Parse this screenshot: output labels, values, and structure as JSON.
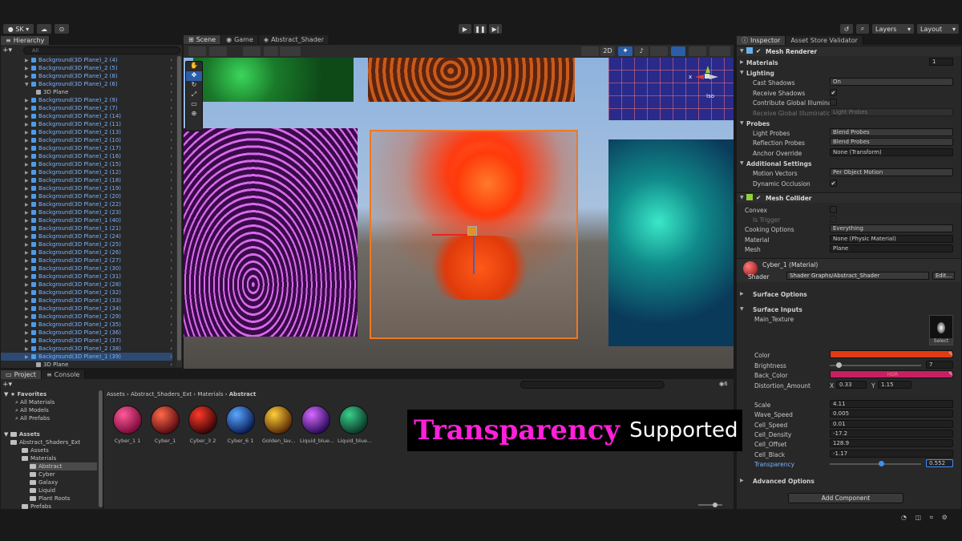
{
  "topbar": {
    "account": "SK",
    "layers": "Layers",
    "layout": "Layout"
  },
  "hierarchy": {
    "tab": "Hierarchy",
    "search_placeholder": "All",
    "rows": [
      {
        "label": "Background(3D Plane)_2 (4)",
        "indent": 0
      },
      {
        "label": "Background(3D Plane)_2 (5)",
        "indent": 0
      },
      {
        "label": "Background(3D Plane)_2 (8)",
        "indent": 0
      },
      {
        "label": "Background(3D Plane)_2 (6)",
        "indent": 0,
        "open": true
      },
      {
        "label": "3D Plane",
        "indent": 1,
        "child": true
      },
      {
        "label": "Background(3D Plane)_2 (9)",
        "indent": 0
      },
      {
        "label": "Background(3D Plane)_2 (7)",
        "indent": 0
      },
      {
        "label": "Background(3D Plane)_2 (14)",
        "indent": 0
      },
      {
        "label": "Background(3D Plane)_2 (11)",
        "indent": 0
      },
      {
        "label": "Background(3D Plane)_2 (13)",
        "indent": 0
      },
      {
        "label": "Background(3D Plane)_2 (10)",
        "indent": 0
      },
      {
        "label": "Background(3D Plane)_2 (17)",
        "indent": 0
      },
      {
        "label": "Background(3D Plane)_2 (16)",
        "indent": 0
      },
      {
        "label": "Background(3D Plane)_2 (15)",
        "indent": 0
      },
      {
        "label": "Background(3D Plane)_2 (12)",
        "indent": 0
      },
      {
        "label": "Background(3D Plane)_2 (18)",
        "indent": 0
      },
      {
        "label": "Background(3D Plane)_2 (19)",
        "indent": 0
      },
      {
        "label": "Background(3D Plane)_2 (20)",
        "indent": 0
      },
      {
        "label": "Background(3D Plane)_2 (22)",
        "indent": 0
      },
      {
        "label": "Background(3D Plane)_2 (23)",
        "indent": 0
      },
      {
        "label": "Background(3D Plane)_1 (40)",
        "indent": 0
      },
      {
        "label": "Background(3D Plane)_1 (21)",
        "indent": 0
      },
      {
        "label": "Background(3D Plane)_2 (24)",
        "indent": 0
      },
      {
        "label": "Background(3D Plane)_2 (25)",
        "indent": 0
      },
      {
        "label": "Background(3D Plane)_2 (26)",
        "indent": 0
      },
      {
        "label": "Background(3D Plane)_2 (27)",
        "indent": 0
      },
      {
        "label": "Background(3D Plane)_2 (30)",
        "indent": 0
      },
      {
        "label": "Background(3D Plane)_2 (31)",
        "indent": 0
      },
      {
        "label": "Background(3D Plane)_2 (28)",
        "indent": 0
      },
      {
        "label": "Background(3D Plane)_2 (32)",
        "indent": 0
      },
      {
        "label": "Background(3D Plane)_2 (33)",
        "indent": 0
      },
      {
        "label": "Background(3D Plane)_2 (34)",
        "indent": 0
      },
      {
        "label": "Background(3D Plane)_2 (29)",
        "indent": 0
      },
      {
        "label": "Background(3D Plane)_2 (35)",
        "indent": 0
      },
      {
        "label": "Background(3D Plane)_2 (36)",
        "indent": 0
      },
      {
        "label": "Background(3D Plane)_2 (37)",
        "indent": 0
      },
      {
        "label": "Background(3D Plane)_2 (38)",
        "indent": 0
      },
      {
        "label": "Background(3D Plane)_1 (39)",
        "indent": 0,
        "selected": true
      },
      {
        "label": "3D Plane",
        "indent": 1,
        "child": true
      }
    ]
  },
  "scene": {
    "tabs": [
      "Scene",
      "Game",
      "Abstract_Shader"
    ],
    "mode_2d": "2D",
    "iso": "Iso"
  },
  "inspector": {
    "tabs": [
      "Inspector",
      "Asset Store Validator"
    ],
    "mesh_renderer": "Mesh Renderer",
    "materials_label": "Materials",
    "materials_count": "1",
    "lighting": "Lighting",
    "cast_shadows_label": "Cast Shadows",
    "cast_shadows": "On",
    "receive_shadows": "Receive Shadows",
    "contribute_gi": "Contribute Global Illuminat",
    "receive_gi_label": "Receive Global Illumination",
    "receive_gi": "Light Probes",
    "probes": "Probes",
    "light_probes_label": "Light Probes",
    "light_probes": "Blend Probes",
    "reflection_probes_label": "Reflection Probes",
    "reflection_probes": "Blend Probes",
    "anchor_override_label": "Anchor Override",
    "anchor_override": "None (Transform)",
    "additional_settings": "Additional Settings",
    "motion_vectors_label": "Motion Vectors",
    "motion_vectors": "Per Object Motion",
    "dynamic_occlusion": "Dynamic Occlusion",
    "mesh_collider": "Mesh Collider",
    "convex": "Convex",
    "is_trigger": "Is Trigger",
    "cooking_label": "Cooking Options",
    "cooking": "Everything",
    "material_label": "Material",
    "material": "None (Physic Material)",
    "mesh_label": "Mesh",
    "mesh": "Plane",
    "material_name": "Cyber_1 (Material)",
    "shader_label": "Shader",
    "shader": "Shader Graphs/Abstract_Shader",
    "edit": "Edit...",
    "surface_options": "Surface Options",
    "surface_inputs": "Surface Inputs",
    "main_texture": "Main_Texture",
    "select": "Select",
    "color_label": "Color",
    "brightness_label": "Brightness",
    "brightness": "7",
    "back_color_label": "Back_Color",
    "hdr": "HDR",
    "distortion_label": "Distortion_Amount",
    "dist_x_label": "X",
    "dist_x": "0.33",
    "dist_y_label": "Y",
    "dist_y": "1.15",
    "scale_label": "Scale",
    "scale": "4.11",
    "wave_speed_label": "Wave_Speed",
    "wave_speed": "0.005",
    "cell_speed_label": "Cell_Speed",
    "cell_speed": "0.01",
    "cell_density_label": "Cell_Density",
    "cell_density": "-17.2",
    "cell_offset_label": "Cell_Offset",
    "cell_offset": "128.9",
    "cell_black_label": "Cell_Black",
    "cell_black": "-1.17",
    "transparency_label": "Transparency",
    "transparency": "0.552",
    "advanced_options": "Advanced Options",
    "add_component": "Add Component",
    "colors": {
      "color": "#e23a12",
      "back_color": "#c81f62"
    },
    "slider_levels": {
      "brightness": 0.07,
      "transparency": 0.552
    }
  },
  "project": {
    "tabs": [
      "Project",
      "Console"
    ],
    "favorites": "Favorites",
    "fav_items": [
      "All Materials",
      "All Models",
      "All Prefabs"
    ],
    "assets": "Assets",
    "tree": [
      "Abstract_Shaders_Ext",
      "Assets",
      "Materials",
      "Abstract",
      "Cyber",
      "Galaxy",
      "Liquid",
      "Plant Roots",
      "Prefabs"
    ],
    "breadcrumb": [
      "Assets",
      "Abstract_Shaders_Ext",
      "Materials",
      "Abstract"
    ],
    "materials": [
      {
        "name": "Cyber_1 1",
        "c1": "#ff5a9a",
        "c2": "#7a0a3a"
      },
      {
        "name": "Cyber_1",
        "c1": "#ff6a4a",
        "c2": "#5a0a10"
      },
      {
        "name": "Cyber_3 2",
        "c1": "#ff3a2a",
        "c2": "#3a0505"
      },
      {
        "name": "Cyber_6 1",
        "c1": "#5aa8ff",
        "c2": "#0a1e5a"
      },
      {
        "name": "Golden_lav...",
        "c1": "#ffcf3a",
        "c2": "#5a2a05"
      },
      {
        "name": "Liquid_blue...",
        "c1": "#d86aff",
        "c2": "#2a0a5a"
      },
      {
        "name": "Liquid_blue...",
        "c1": "#3ad08a",
        "c2": "#0a3a2a"
      }
    ],
    "badge": "6"
  },
  "overlay": {
    "word1": "Transparency",
    "word2": "Supported"
  }
}
